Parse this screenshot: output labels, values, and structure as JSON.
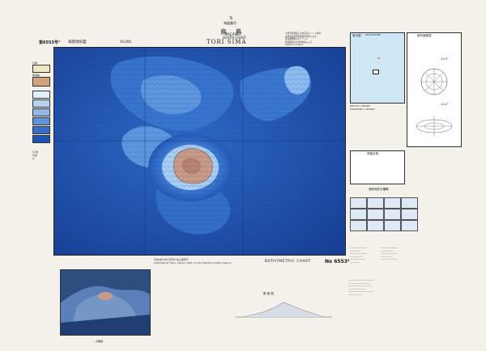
{
  "header": {
    "small_top_1": "Tô",
    "small_top_2": "海図番号",
    "title_jp": "鳥 島",
    "small_mid_1": "PACIFIC",
    "small_mid_2": "SOUTH COAST",
    "title_en": "TORI SIMA",
    "sheet_no": "第6553号⁴",
    "scale_note": "海底地形図",
    "scale_ratio": "50,000",
    "notes_top_right": [
      "平均干低潮面下の水深はメートル単位",
      "基準面は最低低潮面を基準とする",
      "等深線間隔 10メートル",
      "緯度経度は世界測地系による",
      "Depths in metres"
    ]
  },
  "map": {
    "island_color": "#c99a86",
    "deep_color": "#1a4fb3",
    "shallow_color": "#7fb0ea"
  },
  "legend": {
    "title_1": "凡例",
    "title_2": "等深線",
    "items": [
      {
        "label": "",
        "color": "#efe6c2"
      },
      {
        "label": "",
        "color": "#d5a27f"
      },
      {
        "label": "",
        "color": "#e2eef9"
      },
      {
        "label": "",
        "color": "#b8d2ee"
      },
      {
        "label": "",
        "color": "#8fb6e6"
      },
      {
        "label": "",
        "color": "#5f93da"
      },
      {
        "label": "",
        "color": "#3470c9"
      },
      {
        "label": "",
        "color": "#1c55b5"
      }
    ],
    "footer": [
      "凡 例",
      "水深",
      "m"
    ]
  },
  "right_panel": {
    "index_title": "索引図",
    "index_subtitle": "LOCATION MAP",
    "index_label_1": "鳥島",
    "index_label_2": "八丈島",
    "notes_depths": "DEPTHS in METRES",
    "notes_elev": "ELEVATIONS in METRES",
    "mag_title": "磁気偏差図",
    "mag_subtitle": "地磁気",
    "mag_value_1": "-14.5°",
    "mag_value_2": "-14.2°",
    "survey_title": "測量区域",
    "legend_symbols_title": "記号",
    "profile_types": "海底地形の種類",
    "catalog_no": "No 6553⁴",
    "bathy_title": "BATHYMETRIC CHART"
  },
  "bottom": {
    "publisher_jp": "平成9年4月1日刊行 海上保安庁",
    "publisher_en": "Published at Tokyo, Japan, 1997, by the Maritime Safety Agency",
    "persp_caption": "鳥瞰図",
    "profile_caption": "断 面 図",
    "persp_note": "距離 5km"
  }
}
